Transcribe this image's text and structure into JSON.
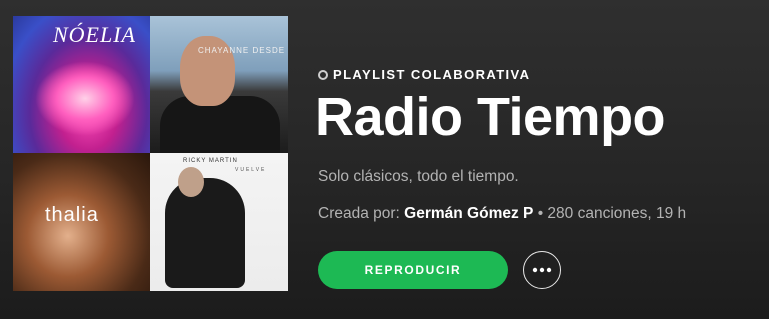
{
  "cover": {
    "tiles": [
      {
        "caption": "NÓELIA"
      },
      {
        "caption": "CHAYANNE DESDE SIEMPRE"
      },
      {
        "caption": "thalia"
      },
      {
        "caption": "RICKY MARTIN",
        "subcaption": "VUELVE"
      }
    ]
  },
  "playlist": {
    "kicker": "PLAYLIST COLABORATIVA",
    "title": "Radio Tiempo",
    "description": "Solo clásicos, todo el tiempo.",
    "created_by_label": "Creada por:",
    "owner": "Germán Gómez P",
    "stats": " • 280 canciones, 19 h"
  },
  "actions": {
    "play_label": "REPRODUCIR",
    "more_icon": "more-horizontal-icon"
  },
  "colors": {
    "accent": "#1db954",
    "secondary_text": "#b3b3b3"
  }
}
